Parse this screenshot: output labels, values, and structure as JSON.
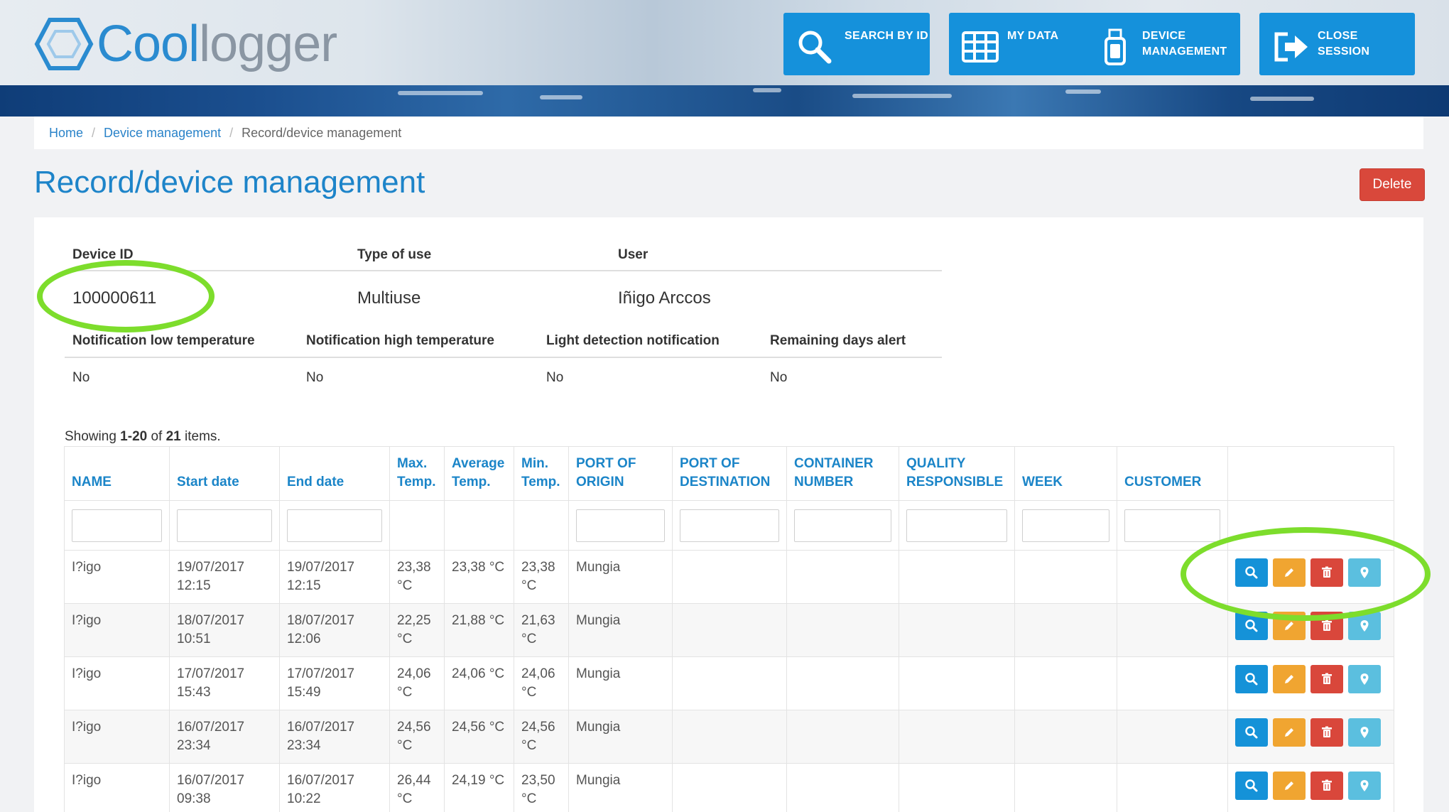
{
  "header": {
    "logo_cool": "Cool",
    "logo_logger": "logger",
    "nav": [
      {
        "line1": "SEARCH BY ID",
        "line2": "",
        "icon": "search-icon"
      },
      {
        "line1": "MY DATA",
        "line2": "",
        "icon": "grid-icon"
      },
      {
        "line1": "DEVICE",
        "line2": "MANAGEMENT",
        "icon": "usb-drive-icon"
      },
      {
        "line1": "CLOSE",
        "line2": "SESSION",
        "icon": "logout-icon"
      }
    ]
  },
  "breadcrumb": [
    "Home",
    "Device management",
    "Record/device management"
  ],
  "page": {
    "title": "Record/device management",
    "delete_label": "Delete"
  },
  "device": {
    "headers": [
      "Device ID",
      "Type of use",
      "User"
    ],
    "values": [
      "100000611",
      "Multiuse",
      "Iñigo Arccos"
    ],
    "notif_headers": [
      "Notification low temperature",
      "Notification high temperature",
      "Light detection notification",
      "Remaining days alert"
    ],
    "notif_values": [
      "No",
      "No",
      "No",
      "No"
    ]
  },
  "summary": {
    "prefix": "Showing ",
    "range": "1-20",
    "mid": " of ",
    "total": "21",
    "suffix": " items."
  },
  "table": {
    "columns": [
      {
        "l1": "",
        "l2": "NAME"
      },
      {
        "l1": "",
        "l2": "Start date"
      },
      {
        "l1": "",
        "l2": "End date"
      },
      {
        "l1": "Max.",
        "l2": "Temp."
      },
      {
        "l1": "Average",
        "l2": "Temp."
      },
      {
        "l1": "Min.",
        "l2": "Temp."
      },
      {
        "l1": "PORT OF",
        "l2": "ORIGIN"
      },
      {
        "l1": "PORT OF",
        "l2": "DESTINATION"
      },
      {
        "l1": "CONTAINER",
        "l2": "NUMBER"
      },
      {
        "l1": "QUALITY",
        "l2": "RESPONSIBLE"
      },
      {
        "l1": "",
        "l2": "WEEK"
      },
      {
        "l1": "",
        "l2": "CUSTOMER"
      },
      {
        "l1": "",
        "l2": ""
      }
    ],
    "rows": [
      {
        "name": "I?igo",
        "start_d": "19/07/2017",
        "start_t": "12:15",
        "end_d": "19/07/2017",
        "end_t": "12:15",
        "max_v": "23,38",
        "max_u": "°C",
        "avg": "23,38 °C",
        "min_v": "23,38",
        "min_u": "°C",
        "origin": "Mungia"
      },
      {
        "name": "I?igo",
        "start_d": "18/07/2017",
        "start_t": "10:51",
        "end_d": "18/07/2017",
        "end_t": "12:06",
        "max_v": "22,25",
        "max_u": "°C",
        "avg": "21,88 °C",
        "min_v": "21,63",
        "min_u": "°C",
        "origin": "Mungia"
      },
      {
        "name": "I?igo",
        "start_d": "17/07/2017",
        "start_t": "15:43",
        "end_d": "17/07/2017",
        "end_t": "15:49",
        "max_v": "24,06",
        "max_u": "°C",
        "avg": "24,06 °C",
        "min_v": "24,06",
        "min_u": "°C",
        "origin": "Mungia"
      },
      {
        "name": "I?igo",
        "start_d": "16/07/2017",
        "start_t": "23:34",
        "end_d": "16/07/2017",
        "end_t": "23:34",
        "max_v": "24,56",
        "max_u": "°C",
        "avg": "24,56 °C",
        "min_v": "24,56",
        "min_u": "°C",
        "origin": "Mungia"
      },
      {
        "name": "I?igo",
        "start_d": "16/07/2017",
        "start_t": "09:38",
        "end_d": "16/07/2017",
        "end_t": "10:22",
        "max_v": "26,44",
        "max_u": "°C",
        "avg": "24,19 °C",
        "min_v": "23,50",
        "min_u": "°C",
        "origin": "Mungia"
      }
    ],
    "actions": [
      "search-icon",
      "pencil-icon",
      "trash-icon",
      "map-pin-icon"
    ]
  },
  "colors": {
    "accent": "#1591db",
    "delete": "#d9483b",
    "edit": "#f0a531",
    "map": "#5bbfdf",
    "annotation": "#7ddd2c"
  }
}
